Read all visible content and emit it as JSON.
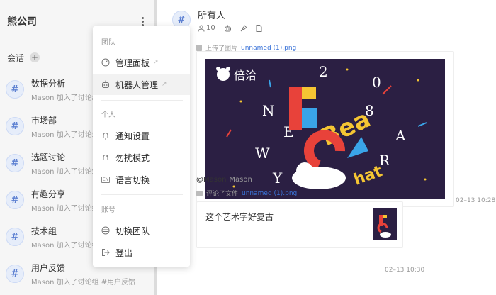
{
  "team": {
    "name": "熊公司"
  },
  "sidebar": {
    "section_label": "会话",
    "add_glyph": "+",
    "conversations": [
      {
        "name": "数据分析",
        "preview": "Mason 加入了讨论组",
        "date": ""
      },
      {
        "name": "市场部",
        "preview": "Mason 加入了讨论组",
        "date": ""
      },
      {
        "name": "选题讨论",
        "preview": "Mason 加入了讨论组",
        "date": ""
      },
      {
        "name": "有趣分享",
        "preview": "Mason 加入了讨论组",
        "date": ""
      },
      {
        "name": "技术组",
        "preview": "Mason 加入了讨论组",
        "date": ""
      },
      {
        "name": "用户反馈",
        "preview": "Mason 加入了讨论组 #用户反馈",
        "date": "02–28"
      }
    ]
  },
  "channel": {
    "title": "所有人",
    "member_count": "10"
  },
  "feed": {
    "upload_action": "上传了图片",
    "upload_file": "unnamed (1).png",
    "image_time": "02–13 10:28",
    "poster_brand": "倍洽",
    "author": "@Mason",
    "author_name": "Mason",
    "comment_action": "评论了文件",
    "comment_file": "unnamed (1).png",
    "comment_text": "这个艺术字好复古",
    "comment_time": "02–13 10:30"
  },
  "menu": {
    "sec_team": "团队",
    "item_admin": "管理面板",
    "item_bots": "机器人管理",
    "sec_personal": "个人",
    "item_notify": "通知设置",
    "item_dnd": "勿扰模式",
    "item_lang": "语言切换",
    "sec_account": "账号",
    "item_switch": "切换团队",
    "item_logout": "登出"
  },
  "icons": {
    "hash": "#",
    "external": "↗",
    "dots": "more-vertical-icon"
  },
  "colors": {
    "accent": "#3a73d8",
    "hash_bg": "#e6edfa",
    "poster_bg": "#2b1f43"
  }
}
